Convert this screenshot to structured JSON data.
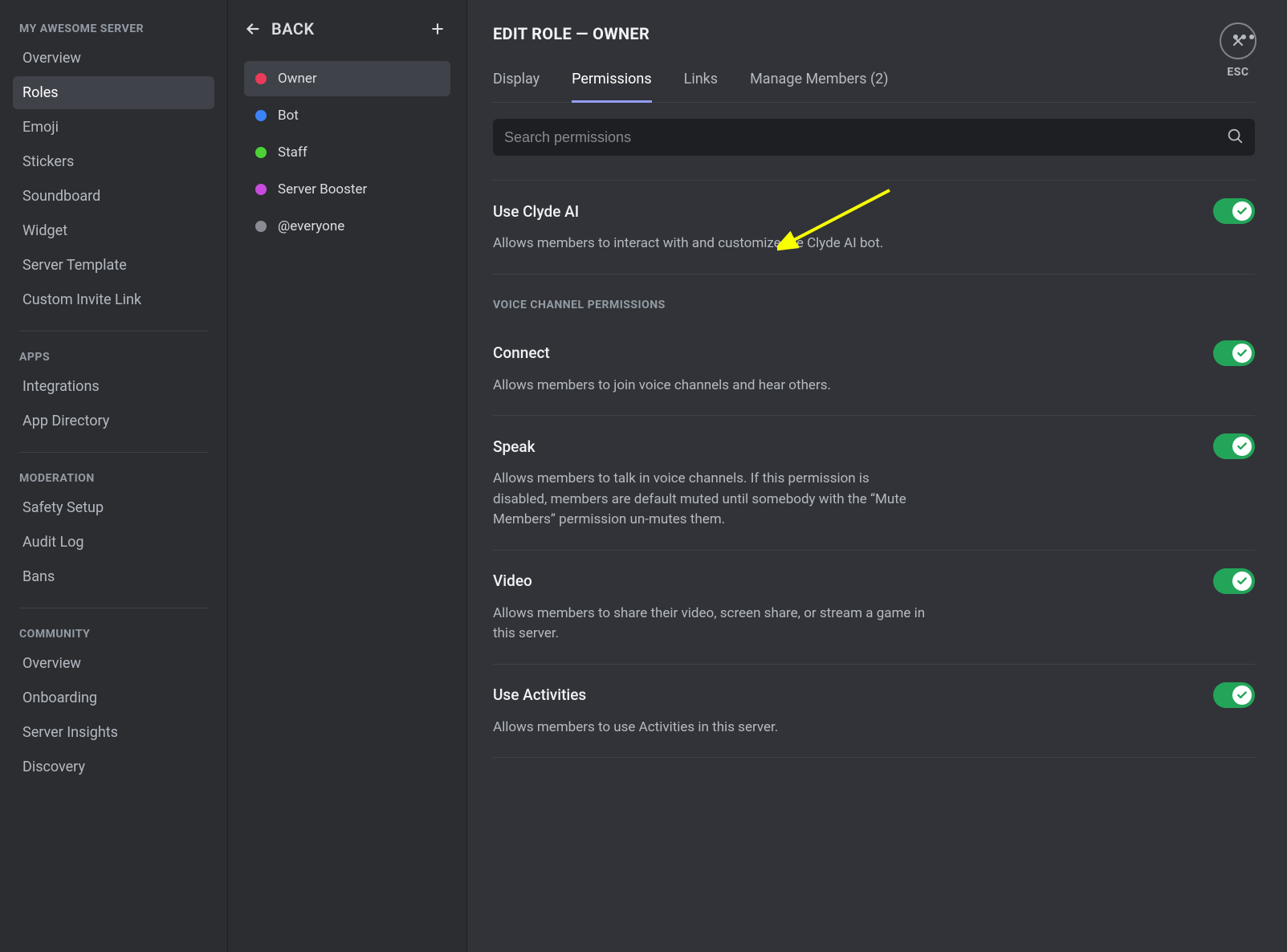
{
  "sidebar": {
    "server_name": "MY AWESOME SERVER",
    "groups": [
      {
        "id": "server",
        "header": "MY AWESOME SERVER",
        "items": [
          {
            "label": "Overview"
          },
          {
            "label": "Roles",
            "active": true
          },
          {
            "label": "Emoji"
          },
          {
            "label": "Stickers"
          },
          {
            "label": "Soundboard"
          },
          {
            "label": "Widget"
          },
          {
            "label": "Server Template"
          },
          {
            "label": "Custom Invite Link"
          }
        ]
      },
      {
        "id": "apps",
        "header": "APPS",
        "items": [
          {
            "label": "Integrations"
          },
          {
            "label": "App Directory"
          }
        ]
      },
      {
        "id": "moderation",
        "header": "MODERATION",
        "items": [
          {
            "label": "Safety Setup"
          },
          {
            "label": "Audit Log"
          },
          {
            "label": "Bans"
          }
        ]
      },
      {
        "id": "community",
        "header": "COMMUNITY",
        "items": [
          {
            "label": "Overview"
          },
          {
            "label": "Onboarding"
          },
          {
            "label": "Server Insights"
          },
          {
            "label": "Discovery"
          }
        ]
      }
    ]
  },
  "roles_col": {
    "back_label": "BACK",
    "roles": [
      {
        "label": "Owner",
        "color": "#eb3b5a",
        "active": true
      },
      {
        "label": "Bot",
        "color": "#3b82f6"
      },
      {
        "label": "Staff",
        "color": "#4cd137"
      },
      {
        "label": "Server Booster",
        "color": "#c84bde"
      },
      {
        "label": "@everyone",
        "color": "#898c92"
      }
    ]
  },
  "main": {
    "title": "EDIT ROLE — OWNER",
    "tabs": [
      {
        "label": "Display"
      },
      {
        "label": "Permissions",
        "active": true
      },
      {
        "label": "Links"
      },
      {
        "label": "Manage Members (2)"
      }
    ],
    "search_placeholder": "Search permissions",
    "permissions": [
      {
        "title": "Use Clyde AI",
        "desc": "Allows members to interact with and customize the Clyde AI bot.",
        "on": true
      }
    ],
    "voice_header": "VOICE CHANNEL PERMISSIONS",
    "voice_permissions": [
      {
        "title": "Connect",
        "desc": "Allows members to join voice channels and hear others.",
        "on": true
      },
      {
        "title": "Speak",
        "desc": "Allows members to talk in voice channels. If this permission is disabled, members are default muted until somebody with the “Mute Members” permission un-mutes them.",
        "on": true
      },
      {
        "title": "Video",
        "desc": "Allows members to share their video, screen share, or stream a game in this server.",
        "on": true
      },
      {
        "title": "Use Activities",
        "desc": "Allows members to use Activities in this server.",
        "on": true
      }
    ],
    "close_label": "ESC"
  }
}
